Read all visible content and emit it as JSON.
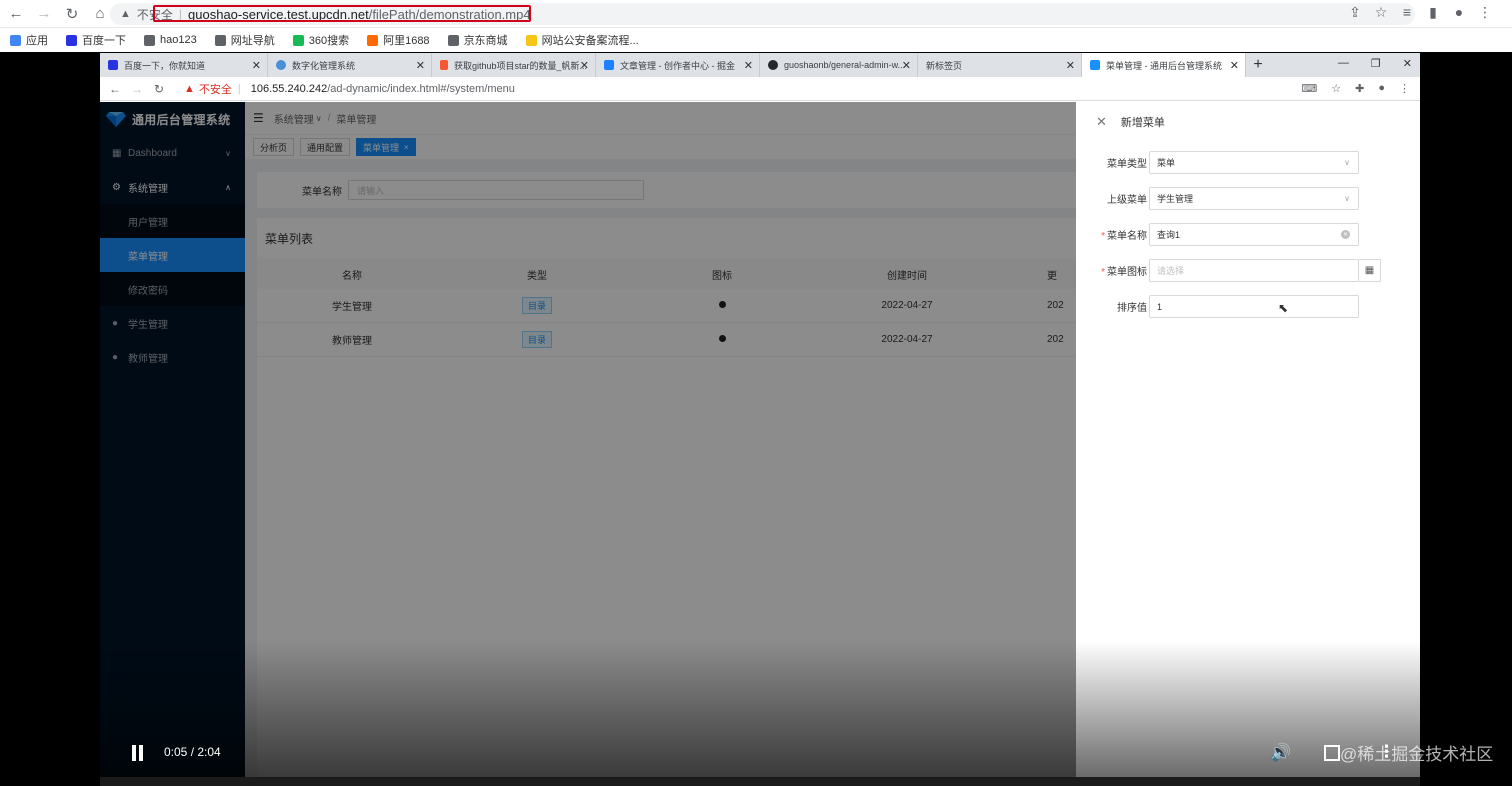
{
  "outer_browser": {
    "insecure_label": "不安全",
    "url_host": "guoshao-service.test.upcdn.net",
    "url_path": "/filePath/demonstration.mp4",
    "bookmarks": [
      {
        "label": "应用",
        "color": "#4285f4"
      },
      {
        "label": "百度一下",
        "color": "#2932e1"
      },
      {
        "label": "hao123",
        "color": "#5f6368"
      },
      {
        "label": "网址导航",
        "color": "#5f6368"
      },
      {
        "label": "360搜索",
        "color": "#19b955"
      },
      {
        "label": "阿里1688",
        "color": "#ff6a00"
      },
      {
        "label": "京东商城",
        "color": "#5f6368"
      },
      {
        "label": "网站公安备案流程...",
        "color": "#f5c518"
      }
    ]
  },
  "inner_browser": {
    "tabs": [
      {
        "label": "百度一下，你就知道",
        "icon": "baidu-icon",
        "color": "#2932e1"
      },
      {
        "label": "数字化管理系统",
        "icon": "globe-icon",
        "color": "#4a90d9"
      },
      {
        "label": "获取github项目star的数量_帆新...",
        "icon": "csdn-icon",
        "color": "#fc5531"
      },
      {
        "label": "文章管理 - 创作者中心 - 掘金",
        "icon": "juejin-icon",
        "color": "#1e80ff"
      },
      {
        "label": "guoshaonb/general-admin-w...",
        "icon": "github-icon",
        "color": "#24292e"
      },
      {
        "label": "新标签页",
        "icon": "",
        "color": ""
      },
      {
        "label": "菜单管理 - 通用后台管理系统",
        "icon": "gem-icon",
        "color": "#1890ff"
      }
    ],
    "insecure_label": "不安全",
    "url_host": "106.55.240.242",
    "url_path": "/ad-dynamic/index.html#/system/menu"
  },
  "app": {
    "title": "通用后台管理系统",
    "menu": {
      "dashboard": "Dashboard",
      "system": "系统管理",
      "users": "用户管理",
      "menus": "菜单管理",
      "password": "修改密码",
      "students": "学生管理",
      "teachers": "教师管理"
    },
    "breadcrumb": [
      "系统管理",
      "菜单管理"
    ],
    "tags": [
      "分析页",
      "通用配置",
      "菜单管理"
    ],
    "search_label": "菜单名称",
    "search_placeholder": "请输入",
    "table_title": "菜单列表",
    "columns": [
      "名称",
      "类型",
      "图标",
      "创建时间",
      "更"
    ],
    "rows": [
      {
        "name": "学生管理",
        "type": "目录",
        "created": "2022-04-27",
        "more": "202"
      },
      {
        "name": "教师管理",
        "type": "目录",
        "created": "2022-04-27",
        "more": "202"
      }
    ]
  },
  "drawer": {
    "title": "新增菜单",
    "fields": {
      "menu_type": {
        "label": "菜单类型",
        "value": "菜单"
      },
      "parent": {
        "label": "上级菜单",
        "value": "学生管理"
      },
      "name": {
        "label": "菜单名称",
        "value": "查询1"
      },
      "icon": {
        "label": "菜单图标",
        "placeholder": "请选择"
      },
      "sort": {
        "label": "排序值",
        "value": "1"
      }
    }
  },
  "video": {
    "time": "0:05 / 2:04",
    "progress": 0.05
  },
  "watermark": "@稀土掘金技术社区",
  "colors": {
    "primary": "#1890ff",
    "sider": "#001529",
    "danger": "#d0021b"
  }
}
